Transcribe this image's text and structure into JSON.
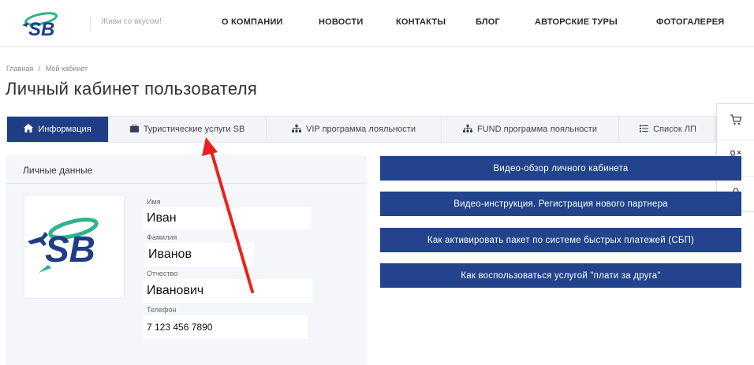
{
  "header": {
    "tagline": "Живи со вкусом!",
    "nav": [
      "О КОМПАНИИ",
      "НОВОСТИ",
      "КОНТАКТЫ",
      "БЛОГ",
      "АВТОРСКИЕ ТУРЫ",
      "ФОТОГАЛЕРЕЯ"
    ],
    "brand_color": "#1f3e86",
    "accent_color": "#2fb38c"
  },
  "breadcrumb": {
    "home": "Главная",
    "separator": "/",
    "current": "Мой кабинет"
  },
  "page_title": "Личный кабинет пользователя",
  "tabs": [
    {
      "label": "Информация",
      "icon": "home-icon",
      "active": true
    },
    {
      "label": "Туристические услуги SB",
      "icon": "briefcase-icon",
      "active": false
    },
    {
      "label": "VIP программа лояльности",
      "icon": "sitemap-icon",
      "active": false
    },
    {
      "label": "FUND программа лояльности",
      "icon": "sitemap-icon",
      "active": false
    },
    {
      "label": "Список ЛП",
      "icon": "list-icon",
      "active": false
    }
  ],
  "side_tools": [
    "cart-icon",
    "phone-icon",
    "lock-icon"
  ],
  "personal": {
    "title": "Личные данные",
    "first_name_label": "Имя",
    "first_name": "Иван",
    "last_name_label": "Фамилия",
    "last_name": "Иванов",
    "patronymic_label": "Отчество",
    "patronymic": "Иванович",
    "phone_label": "Телефон",
    "phone": "7 123 456 7890"
  },
  "buttons": [
    "Видео-обзор личного кабинета",
    "Видео-инструкция. Регистрация нового партнера",
    "Как активировать пакет по системе быстрых платежей (СБП)",
    "Как воспользоваться услугой \"плати за друга\""
  ],
  "annotation_color": "#e8231d"
}
